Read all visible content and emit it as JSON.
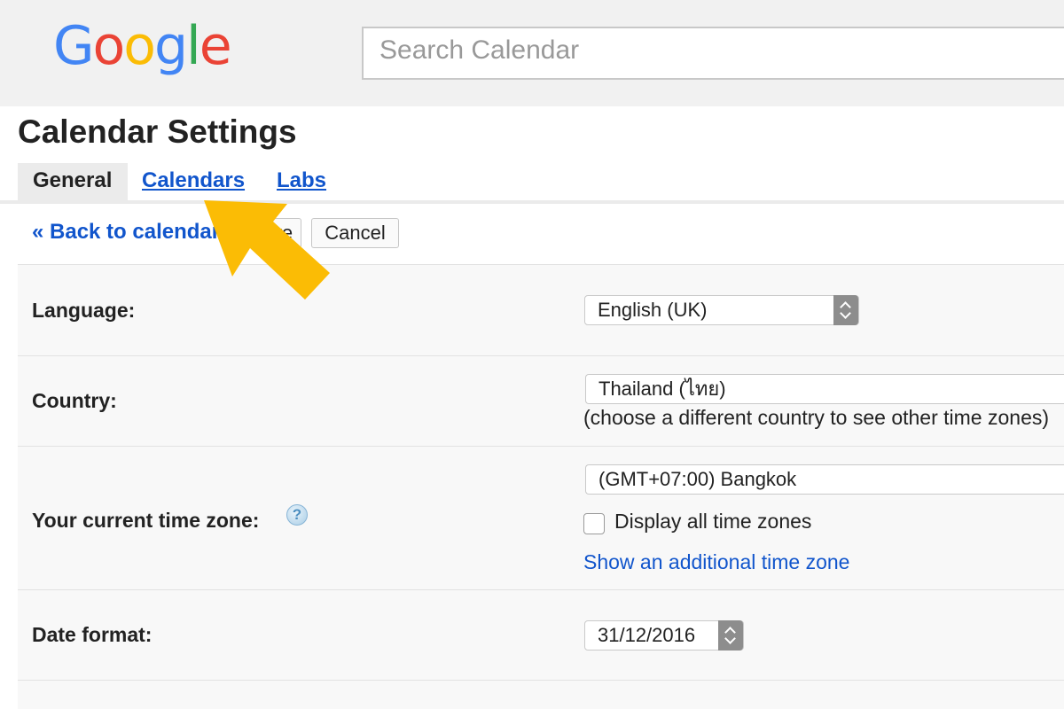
{
  "logo": {
    "letters": [
      "G",
      "o",
      "o",
      "g",
      "l",
      "e"
    ],
    "colors": [
      "#4285F4",
      "#EA4335",
      "#FBBC05",
      "#4285F4",
      "#34A853",
      "#EA4335"
    ]
  },
  "search": {
    "placeholder": "Search Calendar"
  },
  "page": {
    "title": "Calendar Settings"
  },
  "tabs": [
    {
      "label": "General",
      "active": true
    },
    {
      "label": "Calendars",
      "active": false
    },
    {
      "label": "Labs",
      "active": false
    }
  ],
  "actions": {
    "back_label": "« Back to calendar",
    "save_label": "Save",
    "cancel_label": "Cancel"
  },
  "settings": {
    "language": {
      "label": "Language:",
      "value": "English (UK)"
    },
    "country": {
      "label": "Country:",
      "value": "Thailand (ไทย)",
      "note": "(choose a different country to see other time zones)"
    },
    "timezone": {
      "label": "Your current time zone:",
      "help": "?",
      "value": "(GMT+07:00) Bangkok",
      "checkbox_label": "Display all time zones",
      "link_label": "Show an additional time zone"
    },
    "date_format": {
      "label": "Date format:",
      "value": "31/12/2016"
    }
  },
  "colors": {
    "link": "#1155cc",
    "arrow": "#FBBC05",
    "tab_active_bg": "#ebebeb"
  }
}
